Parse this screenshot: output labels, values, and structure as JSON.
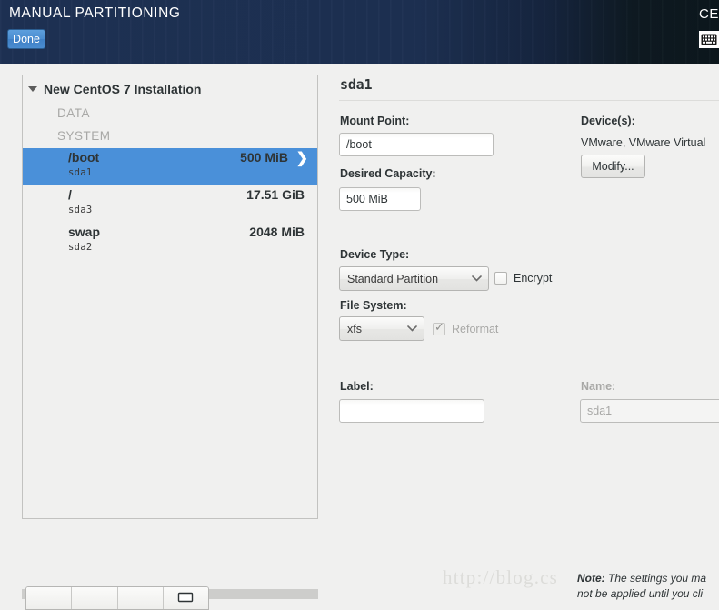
{
  "header": {
    "title": "MANUAL PARTITIONING",
    "done_label": "Done",
    "right_label": "CE",
    "kbd_icon": "keyboard-icon"
  },
  "partition_panel": {
    "tree_root": "New CentOS 7 Installation",
    "groups": [
      {
        "label": "DATA",
        "rows": []
      },
      {
        "label": "SYSTEM",
        "rows": [
          {
            "name": "/boot",
            "device": "sda1",
            "size": "500 MiB",
            "selected": true,
            "chevron": "chevron-right-icon"
          },
          {
            "name": "/",
            "device": "sda3",
            "size": "17.51 GiB",
            "selected": false
          },
          {
            "name": "swap",
            "device": "sda2",
            "size": "2048 MiB",
            "selected": false
          }
        ]
      }
    ],
    "toolbar": [
      {
        "icon": "add-icon",
        "glyph": ""
      },
      {
        "icon": "remove-icon",
        "glyph": ""
      },
      {
        "icon": "configure-icon",
        "glyph": ""
      },
      {
        "icon": "storage-icon",
        "glyph": ""
      }
    ]
  },
  "detail": {
    "title": "sda1",
    "mount_point": {
      "label": "Mount Point:",
      "value": "/boot"
    },
    "desired_capacity": {
      "label": "Desired Capacity:",
      "value": "500 MiB"
    },
    "device_type": {
      "label": "Device Type:",
      "value": "Standard Partition"
    },
    "encrypt": {
      "label": "Encrypt",
      "checked": false
    },
    "file_system": {
      "label": "File System:",
      "value": "xfs"
    },
    "reformat": {
      "label": "Reformat",
      "checked": true,
      "disabled": true
    },
    "label_field": {
      "label": "Label:",
      "value": ""
    },
    "name_field": {
      "label": "Name:",
      "value": "sda1",
      "disabled": true
    },
    "devices": {
      "label": "Device(s):",
      "value": "VMware, VMware Virtual",
      "modify_label": "Modify..."
    }
  },
  "note": {
    "prefix": "Note:",
    "line1": " The settings you ma",
    "line2": "not be applied until you cli"
  },
  "watermark": "http://blog.cs",
  "colors": {
    "header_bg": "#1e3154",
    "header_dark": "#0c171d",
    "selection": "#4a90d9",
    "page_bg": "#f0f0ef",
    "muted_text": "#a8a8a6"
  }
}
